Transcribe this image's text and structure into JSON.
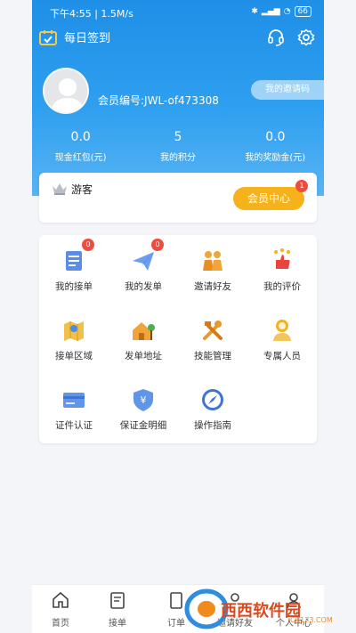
{
  "status_bar": {
    "time": "下午4:55 | 1.5M/s",
    "battery": "66"
  },
  "header": {
    "checkin_label": "每日签到"
  },
  "profile": {
    "member_no": "会员编号:JWL-of473308",
    "invite_label": "我的邀请码"
  },
  "stats": [
    {
      "value": "0.0",
      "label": "现金红包(元)"
    },
    {
      "value": "5",
      "label": "我的积分"
    },
    {
      "value": "0.0",
      "label": "我的奖励金(元)"
    }
  ],
  "guest": {
    "name": "游客",
    "vip_label": "会员中心",
    "vip_badge": "1"
  },
  "grid": [
    {
      "label": "我的接单",
      "badge": "0",
      "icon": "receive-order-icon"
    },
    {
      "label": "我的发单",
      "badge": "0",
      "icon": "send-order-icon"
    },
    {
      "label": "邀请好友",
      "badge": "",
      "icon": "invite-friends-icon"
    },
    {
      "label": "我的评价",
      "badge": "",
      "icon": "review-icon"
    },
    {
      "label": "接单区域",
      "badge": "",
      "icon": "map-icon"
    },
    {
      "label": "发单地址",
      "badge": "",
      "icon": "address-icon"
    },
    {
      "label": "技能管理",
      "badge": "",
      "icon": "tools-icon"
    },
    {
      "label": "专属人员",
      "badge": "",
      "icon": "person-icon"
    },
    {
      "label": "证件认证",
      "badge": "",
      "icon": "id-card-icon"
    },
    {
      "label": "保证金明细",
      "badge": "",
      "icon": "deposit-icon"
    },
    {
      "label": "操作指南",
      "badge": "",
      "icon": "compass-icon"
    }
  ],
  "bottom_nav": [
    {
      "label": "首页",
      "icon": "home-icon"
    },
    {
      "label": "接单",
      "icon": "clipboard-icon"
    },
    {
      "label": "订单",
      "icon": "orders-icon"
    },
    {
      "label": "邀请好友",
      "icon": "invite-icon"
    },
    {
      "label": "个人中心",
      "icon": "user-icon"
    }
  ],
  "watermark": {
    "text": "西西软件园",
    "sub": "CR173.COM"
  },
  "colors": {
    "primary": "#2f9ff0",
    "accent": "#f5b21b",
    "badge": "#ee4c3c"
  }
}
